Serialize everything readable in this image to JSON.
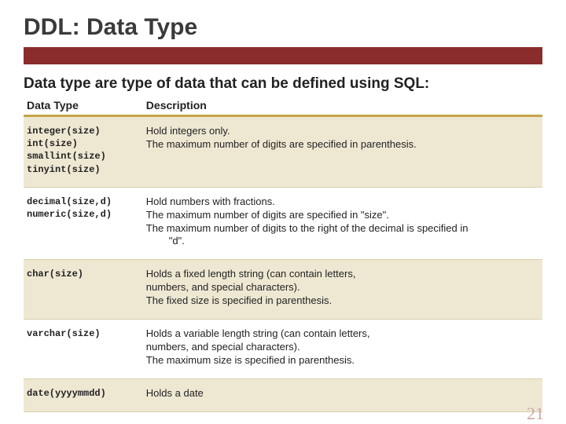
{
  "title": "DDL: Data Type",
  "subtitle": "Data type are type of data that can be defined using SQL:",
  "table": {
    "headers": {
      "col1": "Data Type",
      "col2": "Description"
    },
    "rows": [
      {
        "type": "integer(size)\nint(size)\nsmallint(size)\ntinyint(size)",
        "desc": "Hold integers only.\nThe maximum number of digits are specified in parenthesis."
      },
      {
        "type": "decimal(size,d)\nnumeric(size,d)",
        "desc": "Hold numbers with fractions.\nThe maximum number of digits are specified in \"size\".\nThe maximum number of digits to the right of the decimal is specified in\n        \"d\"."
      },
      {
        "type": "char(size)",
        "desc": "Holds a fixed length string (can contain letters,\nnumbers, and special characters).\nThe fixed size is specified in parenthesis."
      },
      {
        "type": "varchar(size)",
        "desc": "Holds a variable length string (can contain letters,\nnumbers, and special characters).\nThe maximum size is specified in parenthesis."
      },
      {
        "type": "date(yyyymmdd)",
        "desc": "Holds a date"
      }
    ]
  },
  "page_number": "21"
}
